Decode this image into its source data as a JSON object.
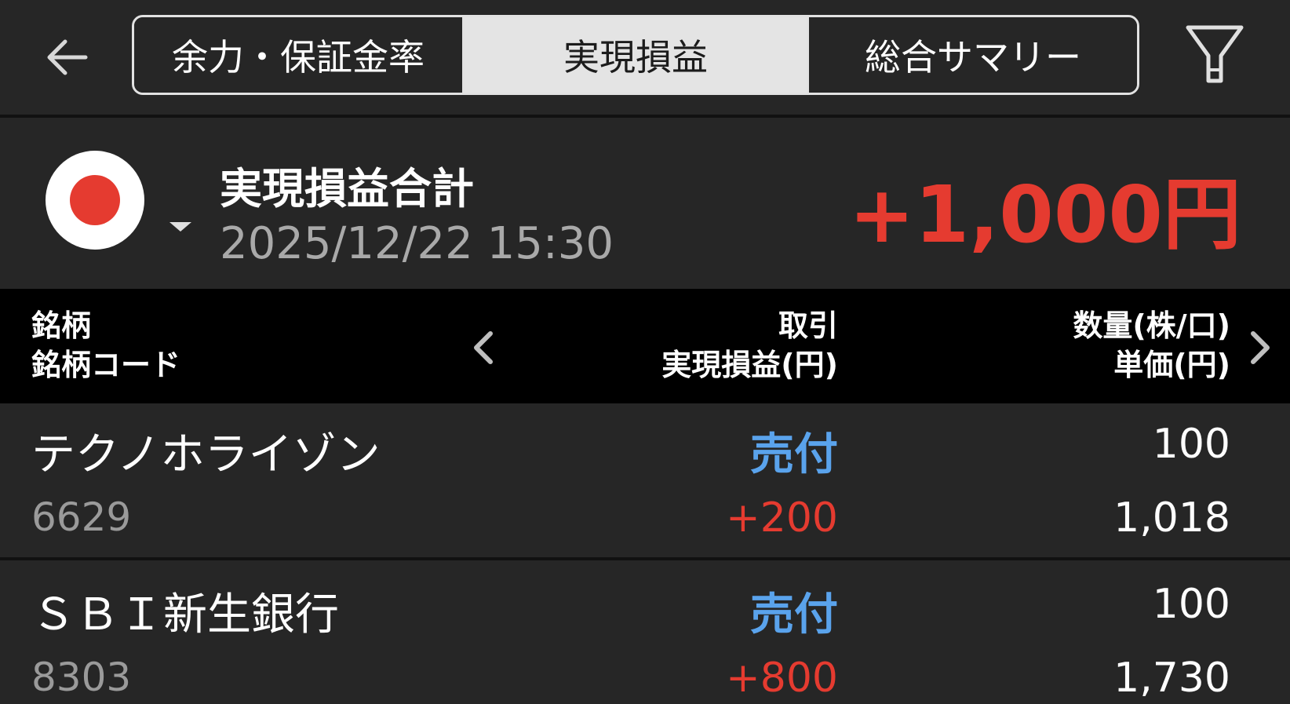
{
  "header": {
    "back_icon": "arrow-left-icon",
    "filter_icon": "filter-funnel-icon",
    "tabs": [
      {
        "label": "余力・保証金率",
        "active": false
      },
      {
        "label": "実現損益",
        "active": true
      },
      {
        "label": "総合サマリー",
        "active": false
      }
    ]
  },
  "summary": {
    "market_icon": "japan-flag-icon",
    "title": "実現損益合計",
    "datetime": "2025/12/22  15:30",
    "total": "+1,000円",
    "total_color": "#e53b30"
  },
  "table": {
    "columns": {
      "left": [
        "銘柄",
        "銘柄コード"
      ],
      "middle": [
        "取引",
        "実現損益(円)"
      ],
      "right": [
        "数量(株/口)",
        "単価(円)"
      ]
    },
    "rows": [
      {
        "name": "テクノホライゾン",
        "code": "6629",
        "trade": "売付",
        "pnl": "+200",
        "quantity": "100",
        "unit_price": "1,018"
      },
      {
        "name": "ＳＢＩ新生銀行",
        "code": "8303",
        "trade": "売付",
        "pnl": "+800",
        "quantity": "100",
        "unit_price": "1,730"
      }
    ]
  },
  "colors": {
    "background": "#262626",
    "header_background": "#000000",
    "profit": "#e53b30",
    "trade_type": "#5aa3ec",
    "secondary_text": "#a9a9a9"
  }
}
